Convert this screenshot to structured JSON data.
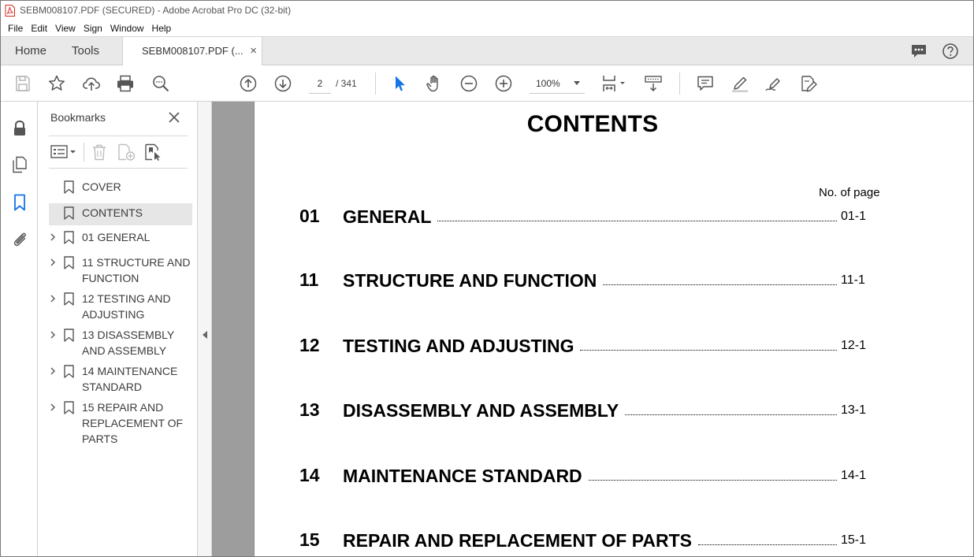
{
  "window": {
    "title": "SEBM008107.PDF (SECURED) - Adobe Acrobat Pro DC (32-bit)"
  },
  "menu": [
    "File",
    "Edit",
    "View",
    "Sign",
    "Window",
    "Help"
  ],
  "tabs": {
    "home": "Home",
    "tools": "Tools",
    "doc": "SEBM008107.PDF (...",
    "close": "×"
  },
  "toolbar": {
    "page_current": "2",
    "page_total": "/ 341",
    "zoom": "100%"
  },
  "bookmarks": {
    "title": "Bookmarks",
    "items": [
      {
        "label": "COVER",
        "expandable": false,
        "selected": false
      },
      {
        "label": "CONTENTS",
        "expandable": false,
        "selected": true
      },
      {
        "label": "01 GENERAL",
        "expandable": true,
        "selected": false
      },
      {
        "label": "11 STRUCTURE AND FUNCTION",
        "expandable": true,
        "selected": false
      },
      {
        "label": "12 TESTING AND ADJUSTING",
        "expandable": true,
        "selected": false
      },
      {
        "label": "13 DISASSEMBLY AND ASSEMBLY",
        "expandable": true,
        "selected": false
      },
      {
        "label": "14 MAINTENANCE STANDARD",
        "expandable": true,
        "selected": false
      },
      {
        "label": "15 REPAIR AND REPLACEMENT OF PARTS",
        "expandable": true,
        "selected": false
      }
    ]
  },
  "document": {
    "title": "CONTENTS",
    "column_header": "No. of page",
    "toc": [
      {
        "num": "01",
        "title": "GENERAL",
        "page": "01-1"
      },
      {
        "num": "11",
        "title": "STRUCTURE AND FUNCTION",
        "page": "11-1"
      },
      {
        "num": "12",
        "title": "TESTING AND ADJUSTING",
        "page": "12-1"
      },
      {
        "num": "13",
        "title": "DISASSEMBLY AND ASSEMBLY",
        "page": "13-1"
      },
      {
        "num": "14",
        "title": "MAINTENANCE STANDARD",
        "page": "14-1"
      },
      {
        "num": "15",
        "title": "REPAIR AND REPLACEMENT OF PARTS",
        "page": "15-1"
      }
    ]
  },
  "colors": {
    "accent": "#1473e6",
    "pdf_red": "#d7281e",
    "page_gutter": "#9d9d9d"
  }
}
